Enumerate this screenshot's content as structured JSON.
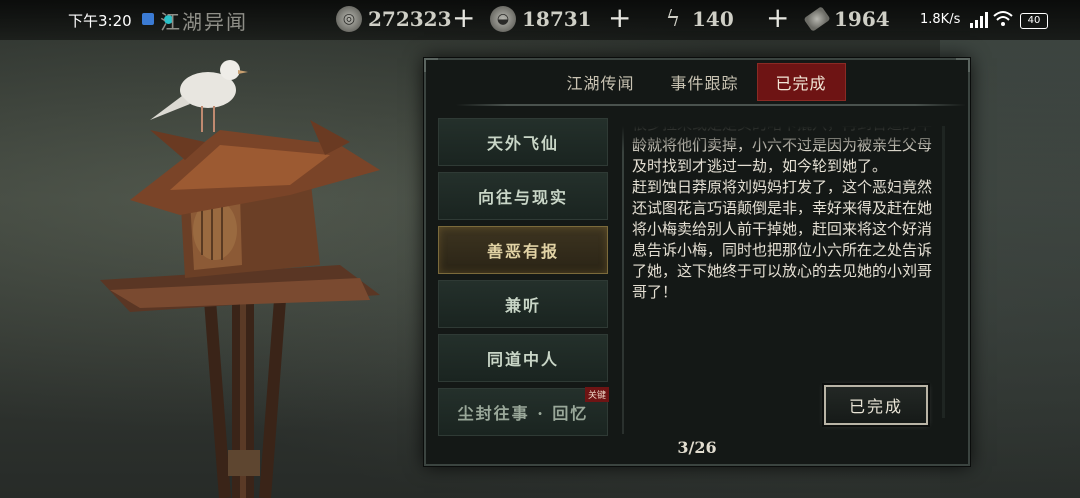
{
  "status_bar": {
    "time": "下午3:20",
    "network_speed": "1.8K/s",
    "battery": "40"
  },
  "game_header": {
    "title": "江湖异闻",
    "resources": [
      {
        "icon": "coin-icon",
        "value": "272323"
      },
      {
        "icon": "silver-ingot-icon",
        "value": "18731"
      },
      {
        "icon": "lightning-icon",
        "value": "140"
      },
      {
        "icon": "ticket-icon",
        "value": "1964"
      }
    ]
  },
  "panel": {
    "tabs": [
      {
        "label": "江湖传闻",
        "active": false
      },
      {
        "label": "事件跟踪",
        "active": false
      },
      {
        "label": "已完成",
        "active": true
      }
    ],
    "events": [
      {
        "label": "天外飞仙",
        "selected": false
      },
      {
        "label": "向往与现实",
        "selected": false
      },
      {
        "label": "善恶有报",
        "selected": true
      },
      {
        "label": "兼听",
        "selected": false
      },
      {
        "label": "同道中人",
        "selected": false
      },
      {
        "label": "尘封往事 · 回忆",
        "selected": false,
        "badge": "关键"
      }
    ],
    "story_paragraphs": [
      "很多拉来或是是买的略卡撬穴，再到合适的年龄就将他们卖掉，小六不过是因为被亲生父母及时找到才逃过一劫，如今轮到她了。",
      "赶到蚀日莽原将刘妈妈打发了，这个恶妇竟然还试图花言巧语颠倒是非，幸好来得及赶在她将小梅卖给别人前干掉她，赶回来将这个好消息告诉小梅，同时也把那位小六所在之处告诉了她，这下她终于可以放心的去见她的小刘哥哥了！"
    ],
    "done_button": "已完成",
    "pager": "3/26"
  }
}
